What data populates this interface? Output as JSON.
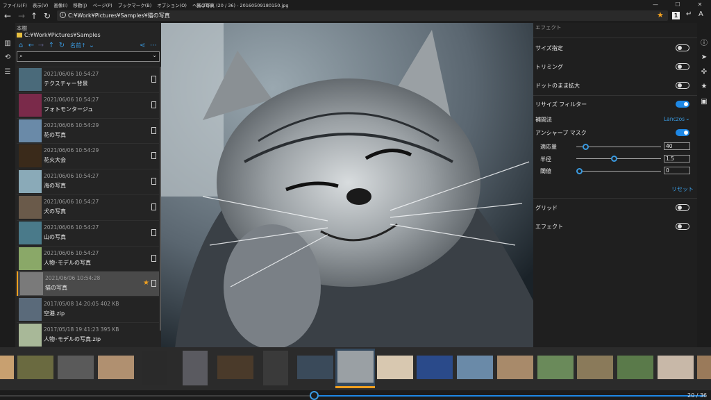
{
  "menu": [
    "ファイル(F)",
    "表示(V)",
    "画像(I)",
    "移動(J)",
    "ページ(P)",
    "ブックマーク(B)",
    "オプション(O)",
    "ヘルプ(H)"
  ],
  "window_title": "猫の写真 (20 / 36) - 20160509180150.jpg",
  "window_controls": {
    "minimize": "—",
    "maximize": "☐",
    "close": "✕"
  },
  "address": {
    "path": "C:¥Work¥Pictures¥Samples¥猫の写真",
    "page_badge": "1"
  },
  "left_panel": {
    "title": "本棚",
    "folder_path": "C:¥Work¥Pictures¥Samples",
    "sort_label": "名前↑",
    "items": [
      {
        "date": "2021/06/06 10:54:27",
        "name": "テクスチャー背景",
        "color": "#4a6a7a"
      },
      {
        "date": "2021/06/06 10:54:27",
        "name": "フォトモンタージュ",
        "color": "#7a2a4a"
      },
      {
        "date": "2021/06/06 10:54:29",
        "name": "花の写真",
        "color": "#6a8aa8"
      },
      {
        "date": "2021/06/06 10:54:29",
        "name": "花火大会",
        "color": "#3a2a1a"
      },
      {
        "date": "2021/06/06 10:54:27",
        "name": "海の写真",
        "color": "#8aaab8"
      },
      {
        "date": "2021/06/06 10:54:27",
        "name": "犬の写真",
        "color": "#6a5a4a"
      },
      {
        "date": "2021/06/06 10:54:27",
        "name": "山の写真",
        "color": "#4a7a8a"
      },
      {
        "date": "2021/06/06 10:54:27",
        "name": "人物･モデルの写真",
        "color": "#8aa868"
      },
      {
        "date": "2021/06/06 10:54:28",
        "name": "猫の写真",
        "color": "#7a7a7a",
        "selected": true
      },
      {
        "date": "2017/05/08 14:20:05   402 KB",
        "name": "空港.zip",
        "color": "#5a6a7a"
      },
      {
        "date": "2017/05/18 19:41:23   395 KB",
        "name": "人物･モデルの写真.zip",
        "color": "#a8b898"
      }
    ]
  },
  "effect_panel": {
    "title": "エフェクト",
    "size_label": "サイズ指定",
    "trim_label": "トリミング",
    "dot_label": "ドットのまま拡大",
    "resize_filter_label": "リサイズ フィルター",
    "interp_label": "補間法",
    "interp_value": "Lanczos",
    "unsharp_label": "アンシャープ マスク",
    "amount_label": "適応量",
    "amount_value": "40",
    "radius_label": "半径",
    "radius_value": "1.5",
    "threshold_label": "閾値",
    "threshold_value": "0",
    "reset_label": "リセット",
    "grid_label": "グリッド",
    "effect_label": "エフェクト"
  },
  "page_count": "20 / 36",
  "colors": {
    "accent": "#1e88e5",
    "highlight": "#f0a020"
  }
}
